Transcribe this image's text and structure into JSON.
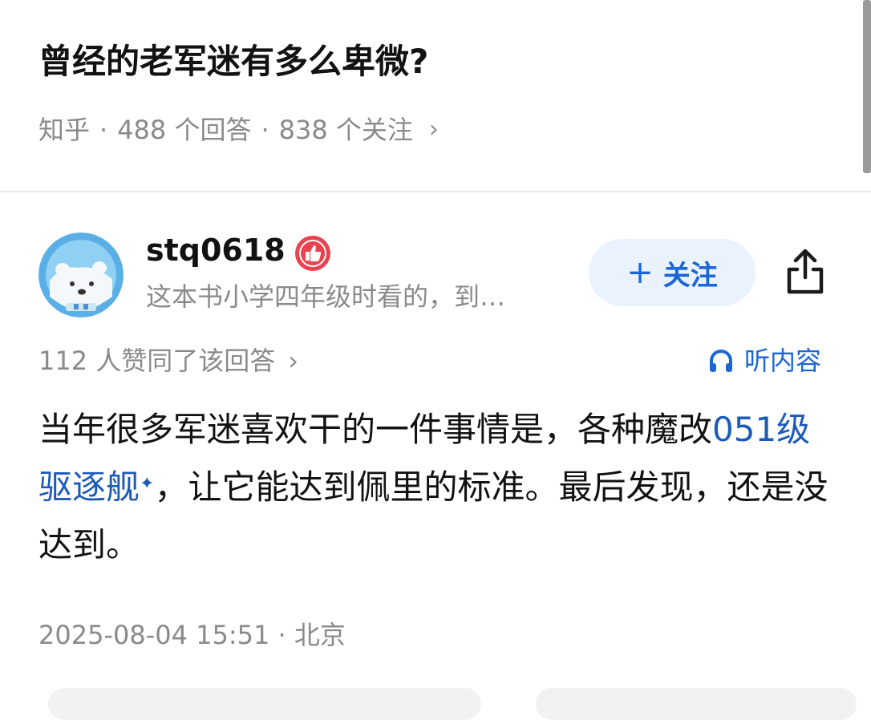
{
  "question": {
    "title": "曾经的老军迷有多么卑微?",
    "source": "知乎",
    "separator": "·",
    "answers_count": "488 个回答",
    "followers_count": "838 个关注",
    "chevron": "›"
  },
  "author": {
    "name": "stq0618",
    "bio": "这本书小学四年级时看的，到…",
    "avatar_icon": "polar-bear-astronaut-avatar",
    "badge_icon": "thumbs-up-badge-icon",
    "follow_plus": "+",
    "follow_label": "关注",
    "share_icon": "share-icon"
  },
  "answer": {
    "approval_text": "112 人赞同了该回答",
    "approval_chevron": "›",
    "listen_label": "听内容",
    "listen_icon": "headphones-icon",
    "body_part1": "当年很多军迷喜欢干的一件事情是，各种魔改",
    "link_text": "051级驱逐舰",
    "link_mark": "✦",
    "body_part2": "，让它能达到佩里的标准。最后发现，还是没达到。",
    "timestamp": "2025-08-04 15:51",
    "location_separator": "·",
    "location": "北京"
  },
  "colors": {
    "accent": "#1a66d6",
    "link": "#1a5bb8",
    "follow_bg": "#eaf2fd",
    "muted_text": "#8a8a8a",
    "main_text": "#121212",
    "badge_red": "#e8434e"
  }
}
